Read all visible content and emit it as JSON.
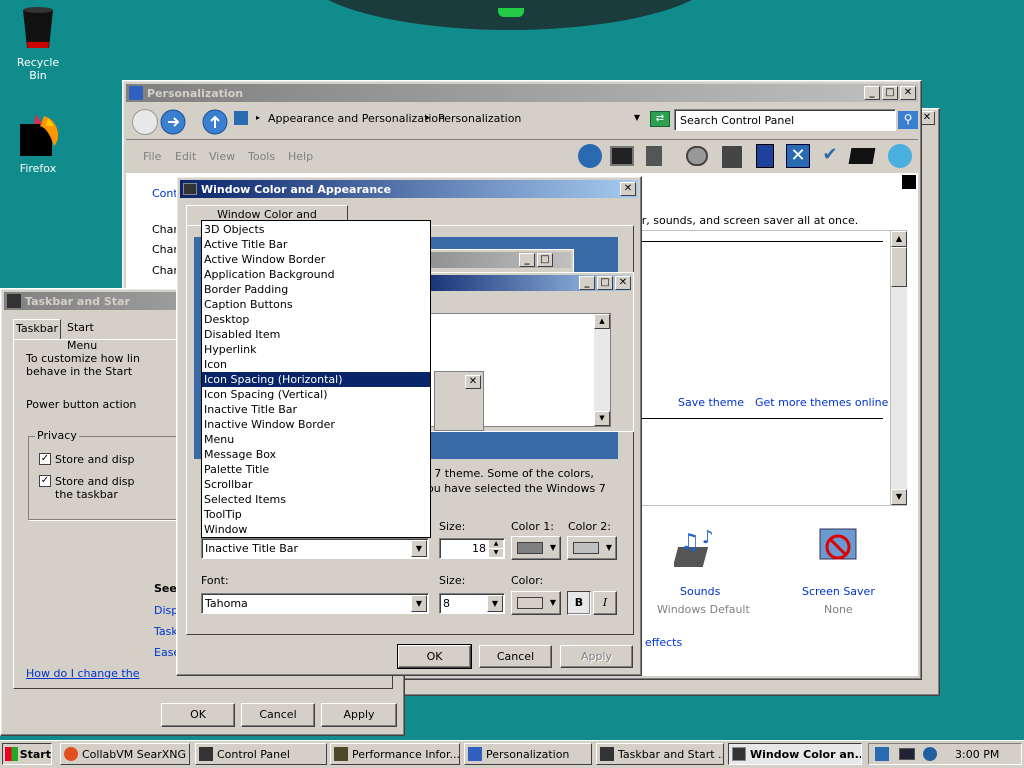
{
  "desktop": {
    "icons": [
      {
        "label": "Recycle Bin",
        "icon": "recycle-bin-icon"
      },
      {
        "label": "Firefox",
        "icon": "firefox-icon"
      }
    ]
  },
  "cp": {
    "title": "Personalization",
    "breadcrumb": [
      "Appearance and Personalization",
      "Personalization"
    ],
    "search_placeholder": "Search Control Panel",
    "menu": [
      "File",
      "Edit",
      "View",
      "Tools",
      "Help"
    ],
    "left_text": [
      "Cont",
      "Chan",
      "Chan",
      "Chan"
    ],
    "header_text": "or, sounds, and screen saver all at once.",
    "save_theme": "Save theme",
    "get_more": "Get more themes online",
    "sounds_label": "Sounds",
    "sounds_value": "Windows Default",
    "screensaver_label": "Screen Saver",
    "screensaver_value": "None",
    "effects_text": "effects"
  },
  "taskbar_props": {
    "title": "Taskbar and Star",
    "tabs": [
      "Taskbar",
      "Start Menu"
    ],
    "desc1": "To customize how lin",
    "desc2": "behave in the Start",
    "power_label": "Power button action",
    "privacy_label": "Privacy",
    "check1": "Store and disp",
    "check2a": "Store and disp",
    "check2b": "the taskbar",
    "see_label": "See",
    "links": [
      "Displ",
      "Task",
      "Ease"
    ],
    "help_link": "How do I change the",
    "ok": "OK",
    "cancel": "Cancel",
    "apply": "Apply"
  },
  "wca": {
    "title": "Window Color and Appearance",
    "tab": "Window Color and Appearance",
    "desc1": "s 7 theme.  Some of the colors,",
    "desc2": "ou have selected the Windows 7",
    "items": [
      "3D Objects",
      "Active Title Bar",
      "Active Window Border",
      "Application Background",
      "Border Padding",
      "Caption Buttons",
      "Desktop",
      "Disabled Item",
      "Hyperlink",
      "Icon",
      "Icon Spacing (Horizontal)",
      "Icon Spacing (Vertical)",
      "Inactive Title Bar",
      "Inactive Window Border",
      "Menu",
      "Message Box",
      "Palette Title",
      "Scrollbar",
      "Selected Items",
      "ToolTip",
      "Window"
    ],
    "selected_index": 10,
    "item_value": "Inactive Title Bar",
    "size_label": "Size:",
    "size_value": "18",
    "color1_label": "Color 1:",
    "color2_label": "Color 2:",
    "font_label": "Font:",
    "font_value": "Tahoma",
    "font_size_label": "Size:",
    "font_size_value": "8",
    "color_label": "Color:",
    "bold": "B",
    "italic": "I",
    "ok": "OK",
    "cancel": "Cancel",
    "apply": "Apply",
    "color1": "#808080",
    "color2": "#c0c0c0",
    "font_color": "#d4d0c8"
  },
  "taskbar": {
    "start": "Start",
    "tasks": [
      "CollabVM SearXNG ...",
      "Control Panel",
      "Performance Infor...",
      "Personalization",
      "Taskbar and Start ...",
      "Window Color an..."
    ],
    "clock": "3:00 PM"
  }
}
